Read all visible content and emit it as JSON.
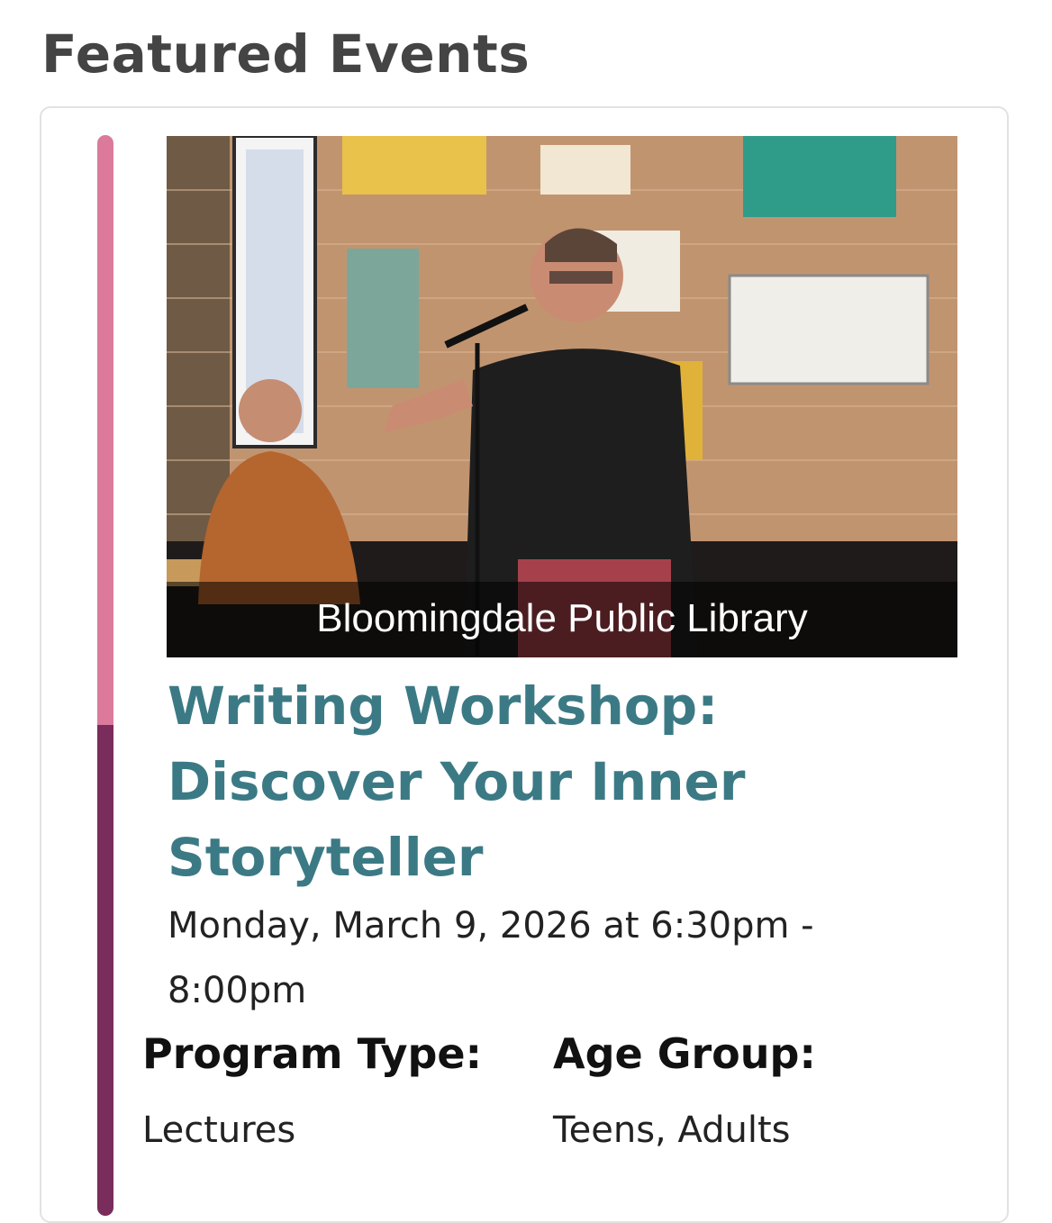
{
  "page": {
    "heading": "Featured Events"
  },
  "event": {
    "image_caption": "Bloomingdale Public Library",
    "title": "Writing Workshop: Discover Your Inner Storyteller",
    "datetime": "Monday, March 9, 2026 at 6:30pm - 8:00pm",
    "program_type_label": "Program Type:",
    "age_group_label": "Age Group:",
    "program_type_value": "Lectures",
    "age_group_value": "Teens, Adults"
  },
  "colors": {
    "heading": "#444444",
    "title": "#3b7a85",
    "accent_top": "#db7a9a",
    "accent_bottom": "#7a2c5c"
  }
}
